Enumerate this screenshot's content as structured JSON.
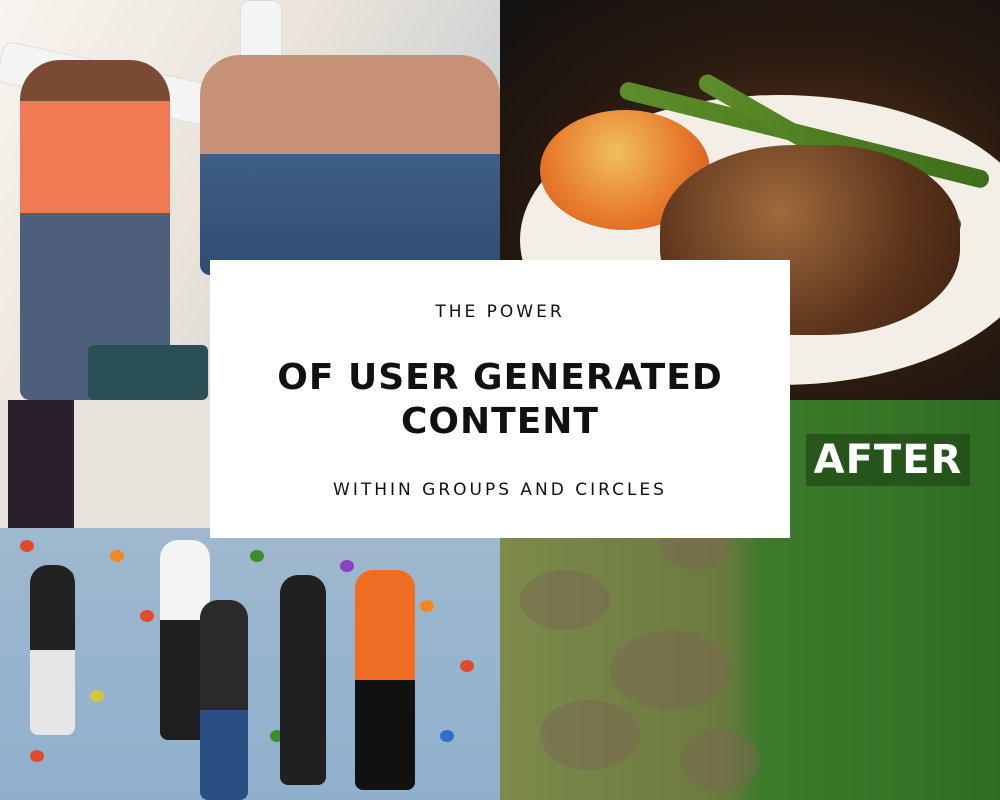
{
  "card": {
    "kicker": "THE POWER",
    "headline_line1": "OF USER GENERATED",
    "headline_line2": "CONTENT",
    "subline": "WITHIN GROUPS AND CIRCLES"
  },
  "photos": {
    "lawn_label": "AFTER"
  },
  "colors": {
    "card_background": "#ffffff",
    "text": "#111111",
    "lawn_label_text": "#ffffff"
  }
}
